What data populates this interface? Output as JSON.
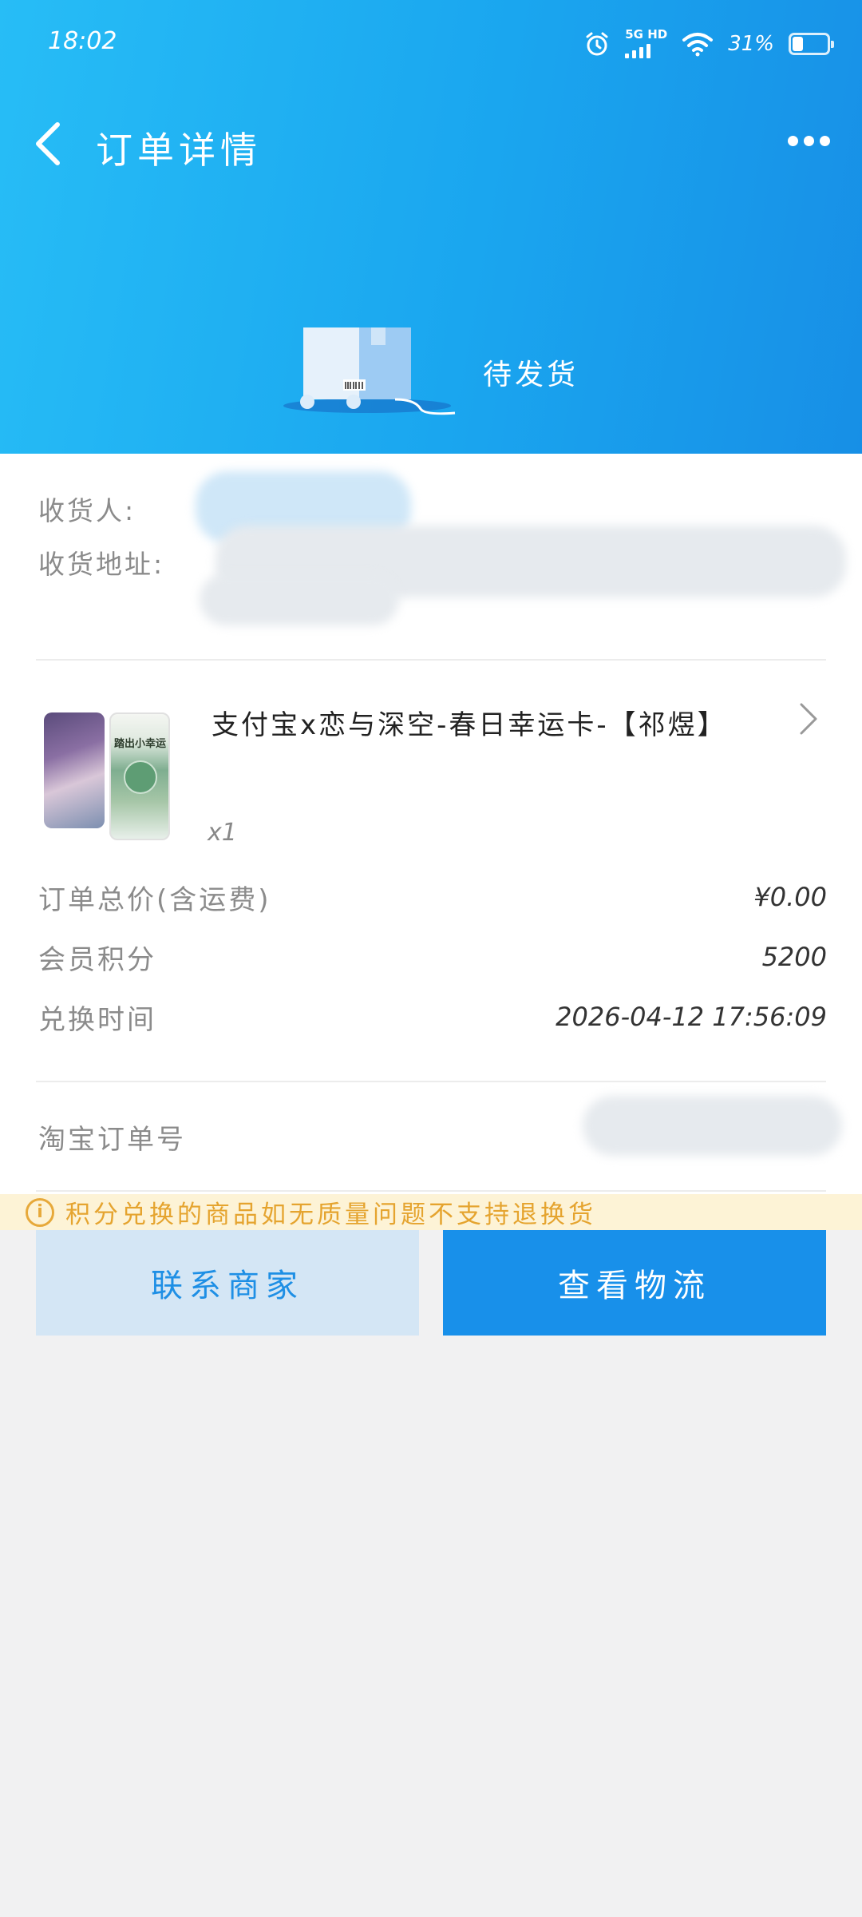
{
  "status_bar": {
    "time": "18:02",
    "network_label": "5G HD",
    "battery_percent": "31%",
    "battery_level": 0.31
  },
  "header": {
    "title": "订单详情",
    "order_status": "待发货"
  },
  "recipient": {
    "name_label": "收货人:",
    "address_label": "收货地址:"
  },
  "product": {
    "title": "支付宝x恋与深空-春日幸运卡-【祁煜】",
    "quantity": "x1",
    "thumb_caption": "踏出小幸运"
  },
  "order_info": [
    {
      "label": "订单总价(含运费)",
      "value": "¥0.00"
    },
    {
      "label": "会员积分",
      "value": "5200"
    },
    {
      "label": "兑换时间",
      "value": "2026-04-12 17:56:09"
    }
  ],
  "taobao_order": {
    "label": "淘宝订单号"
  },
  "notice": {
    "icon": "info-icon",
    "text": "积分兑换的商品如无质量问题不支持退换货",
    "color": "#e5a42f"
  },
  "actions": {
    "contact_label": "联系商家",
    "logistics_label": "查看物流"
  },
  "colors": {
    "brand_blue": "#1890ea",
    "header_gradient_start": "#27bdf6",
    "header_gradient_end": "#178fe6"
  }
}
